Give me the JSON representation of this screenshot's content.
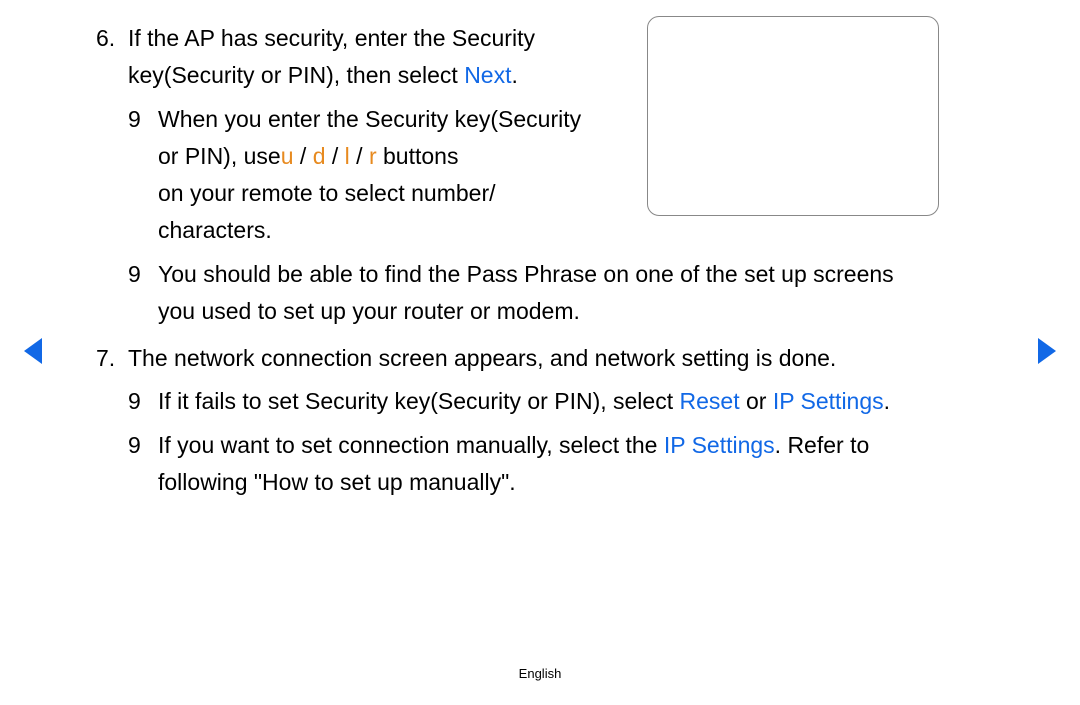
{
  "step6": {
    "number": "6.",
    "line_a": "If the AP has security, enter the Security",
    "line_b_pre": "key(Security or PIN), then select ",
    "next": "Next",
    "line_b_post": ".",
    "bullet1": {
      "sym": "9",
      "l1": "When you enter the Security key(Security",
      "l2_pre": "or PIN), use",
      "u": "u",
      "sep1": " / ",
      "d": "d",
      "sep2": " / ",
      "l": "l",
      "sep3": " / ",
      "r": "r",
      "l2_post": " buttons",
      "l3": "on your remote to select number/",
      "l4": "characters."
    },
    "bullet2": {
      "sym": "9",
      "l1": "You should be able to find the Pass Phrase on one of the set up screens",
      "l2": "you used to set up your router or modem."
    }
  },
  "step7": {
    "number": "7.",
    "text": "The network connection screen appears, and network setting is done.",
    "bullet1": {
      "sym": "9",
      "pre": "If it fails to set Security key(Security or PIN), select ",
      "reset": "Reset",
      "mid": " or ",
      "ip": "IP Settings",
      "post": "."
    },
    "bullet2": {
      "sym": "9",
      "pre": "If you want to set connection manually, select the ",
      "ip": "IP Settings",
      "mid": ". Refer to",
      "l2": "following \"How to set up manually\"."
    }
  },
  "footer": "English"
}
